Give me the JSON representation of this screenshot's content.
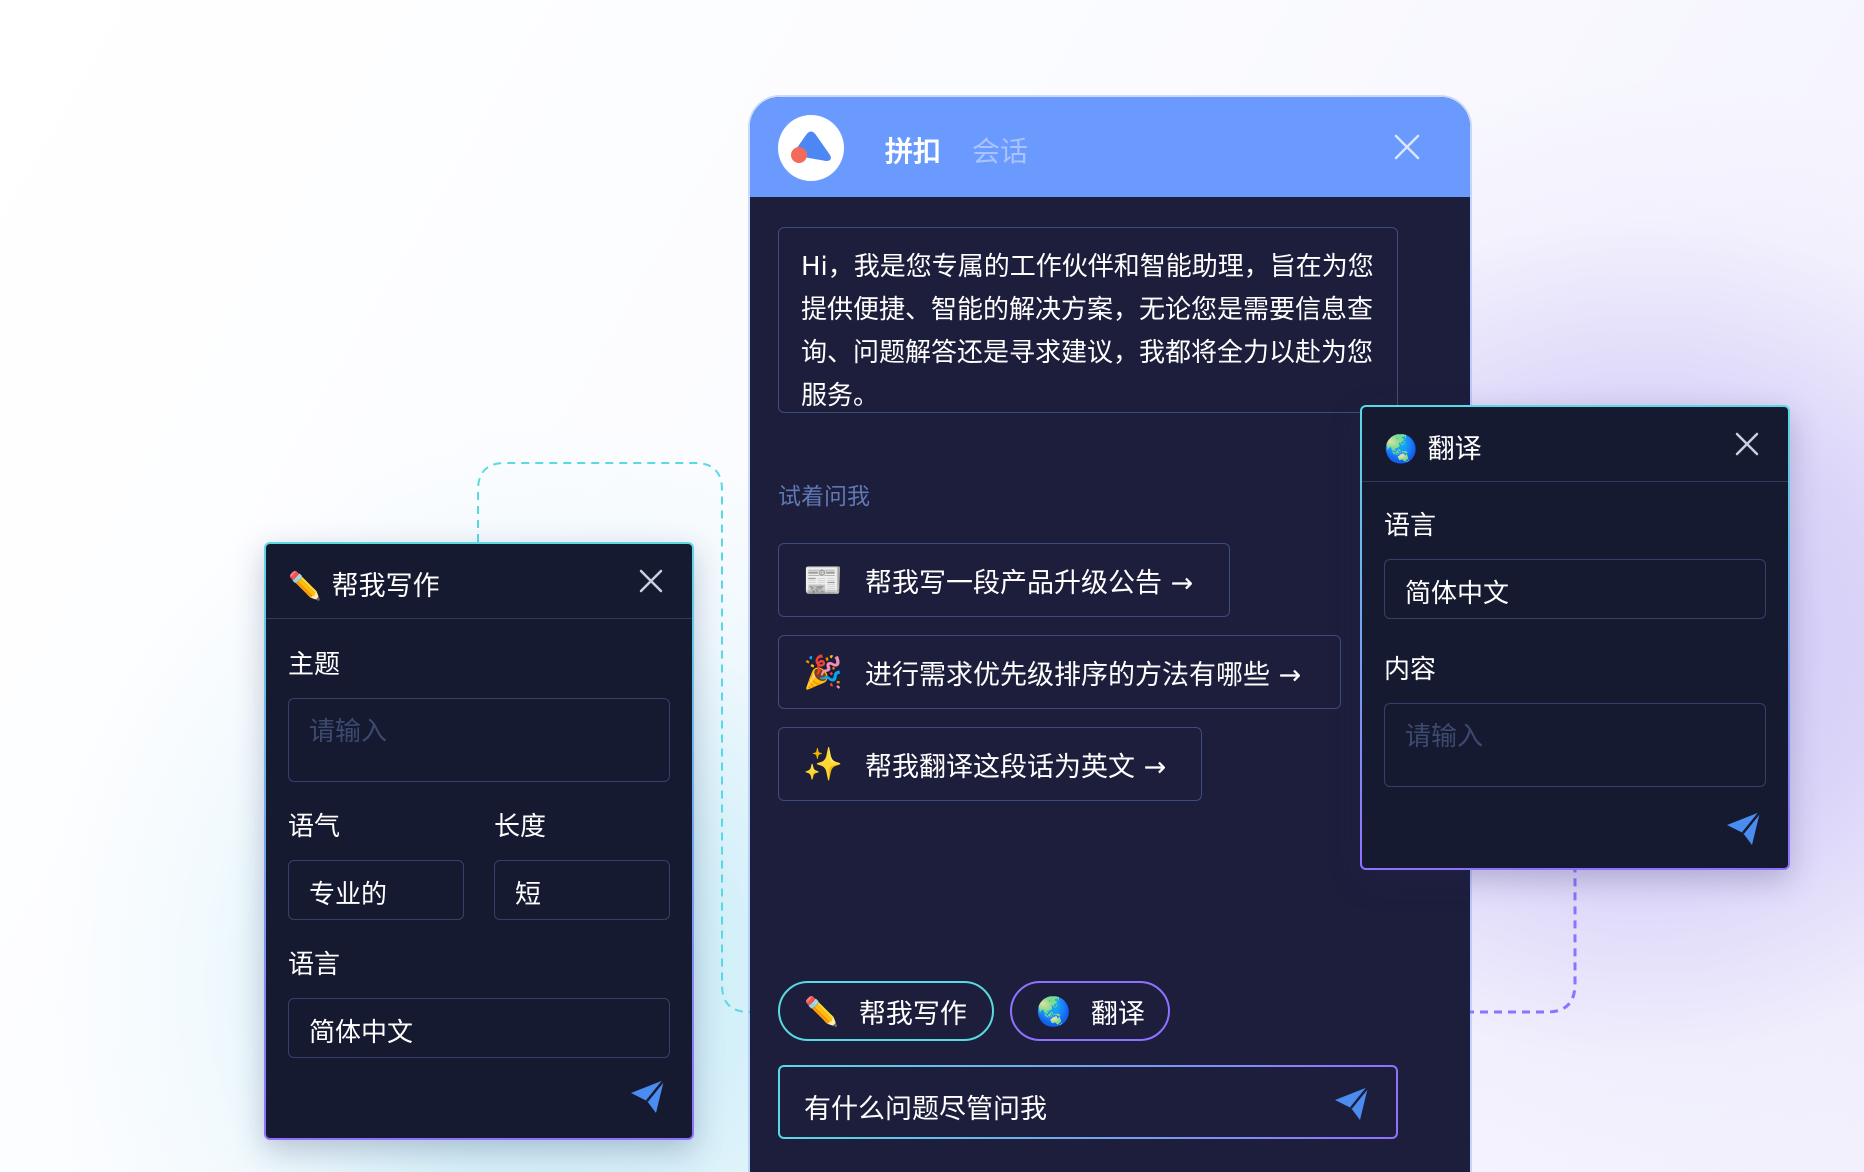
{
  "chat": {
    "app_name": "拼扣",
    "tab_session": "会话",
    "greeting": "Hi，我是您专属的工作伙伴和智能助理，旨在为您提供便捷、智能的解决方案，无论您是需要信息查询、问题解答还是寻求建议，我都将全力以赴为您服务。",
    "try_label": "试着问我",
    "suggestions": [
      {
        "icon": "newspaper-icon",
        "emoji": "📰",
        "label": "帮我写一段产品升级公告 →"
      },
      {
        "icon": "party-popper-icon",
        "emoji": "🎉",
        "label": "进行需求优先级排序的方法有哪些 →"
      },
      {
        "icon": "sparkles-icon",
        "emoji": "✨",
        "label": "帮我翻译这段话为英文 →"
      }
    ],
    "chips": [
      {
        "icon": "pencil-icon",
        "emoji": "✏️",
        "label": "帮我写作"
      },
      {
        "icon": "globe-icon",
        "emoji": "🌏",
        "label": "翻译"
      }
    ],
    "input_placeholder": "有什么问题尽管问我"
  },
  "write_panel": {
    "icon": "pencil-icon",
    "emoji": "✏️",
    "title": "帮我写作",
    "topic_label": "主题",
    "topic_placeholder": "请输入",
    "tone_label": "语气",
    "tone_value": "专业的",
    "length_label": "长度",
    "length_value": "短",
    "language_label": "语言",
    "language_value": "简体中文"
  },
  "translate_panel": {
    "icon": "globe-icon",
    "emoji": "🌏",
    "title": "翻译",
    "language_label": "语言",
    "language_value": "简体中文",
    "content_label": "内容",
    "content_placeholder": "请输入"
  },
  "colors": {
    "header_blue": "#6b9aff",
    "window_dark": "#1d1e3c",
    "panel_dark": "#161a30",
    "accent_cyan": "#5ad9e3",
    "accent_purple": "#8f71ff",
    "send_blue": "#4a8cf0"
  }
}
